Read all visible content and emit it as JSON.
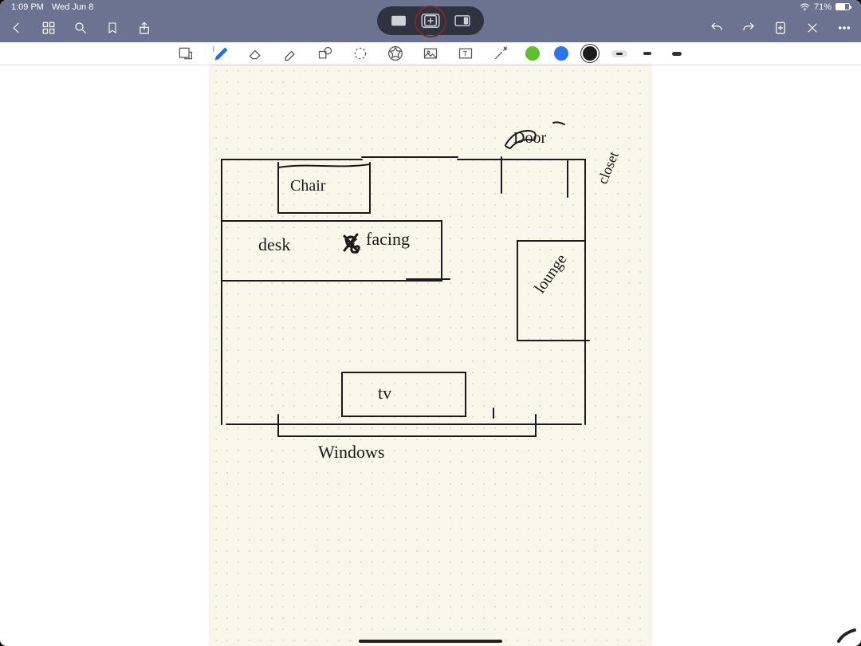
{
  "status": {
    "time": "1:09 PM",
    "date": "Wed Jun 8",
    "battery_pct": "71%"
  },
  "colors": {
    "green": "#5bbf2b",
    "blue": "#2a73e8",
    "black": "#1c1c1c"
  },
  "stroke_sizes": [
    {
      "w": 8,
      "h": 3,
      "selected": true
    },
    {
      "w": 10,
      "h": 4,
      "selected": false
    },
    {
      "w": 12,
      "h": 5,
      "selected": false
    }
  ],
  "sketch_labels": {
    "door": "Door",
    "closet": "closet",
    "chair": "Chair",
    "desk": "desk",
    "facing": "facing",
    "lounge": "lounge",
    "tv": "tv",
    "windows": "Windows"
  }
}
